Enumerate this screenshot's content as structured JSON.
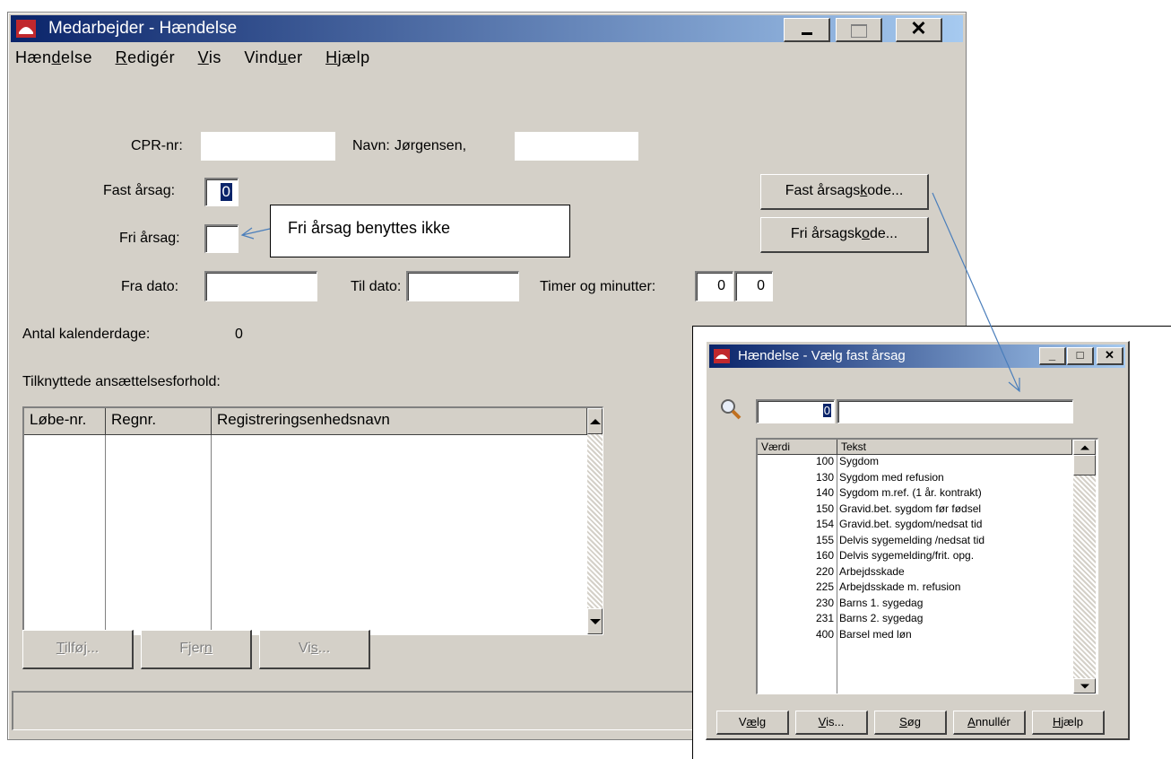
{
  "main_window": {
    "title": "Medarbejder - Hændelse",
    "menu": [
      "Hændelse",
      "Redigér",
      "Vis",
      "Vinduer",
      "Hjælp"
    ],
    "cpr_label": "CPR-nr:",
    "navn_label": "Navn:",
    "navn_value": "Jørgensen,",
    "fast_aarsag_label": "Fast årsag:",
    "fast_aarsag_value": "0",
    "fri_aarsag_label": "Fri årsag:",
    "fra_dato_label": "Fra dato:",
    "til_dato_label": "Til dato:",
    "timer_label": "Timer og minutter:",
    "timer_value": "0",
    "minutter_value": "0",
    "antal_label": "Antal kalenderdage:",
    "antal_value": "0",
    "tilknyttede_label": "Tilknyttede ansættelsesforhold:",
    "columns": [
      "Løbe-nr.",
      "Regnr.",
      "Registreringsenhedsnavn"
    ],
    "fast_button": "Fast årsagskode...",
    "fri_button": "Fri årsagskode...",
    "tilfoej_button": "Tilføj...",
    "fjern_button": "Fjern",
    "vis_button": "Vis..."
  },
  "callout": {
    "text": "Fri årsag benyttes ikke"
  },
  "dialog": {
    "title": "Hændelse - Vælg fast årsag",
    "search_value": "0",
    "columns": [
      "Værdi",
      "Tekst"
    ],
    "rows": [
      {
        "value": "100",
        "text": "Sygdom"
      },
      {
        "value": "130",
        "text": "Sygdom med refusion"
      },
      {
        "value": "140",
        "text": "Sygdom m.ref. (1 år. kontrakt)"
      },
      {
        "value": "150",
        "text": "Gravid.bet. sygdom før fødsel"
      },
      {
        "value": "154",
        "text": "Gravid.bet. sygdom/nedsat tid"
      },
      {
        "value": "155",
        "text": "Delvis sygemelding /nedsat tid"
      },
      {
        "value": "160",
        "text": "Delvis sygemelding/frit. opg."
      },
      {
        "value": "220",
        "text": "Arbejdsskade"
      },
      {
        "value": "225",
        "text": "Arbejdsskade m. refusion"
      },
      {
        "value": "230",
        "text": "Barns 1. sygedag"
      },
      {
        "value": "231",
        "text": "Barns 2. sygedag"
      },
      {
        "value": "400",
        "text": "Barsel med løn"
      }
    ],
    "buttons": {
      "vaelg": "Vælg",
      "vis": "Vis...",
      "soeg": "Søg",
      "annuller": "Annullér",
      "hjaelp": "Hjælp"
    }
  }
}
